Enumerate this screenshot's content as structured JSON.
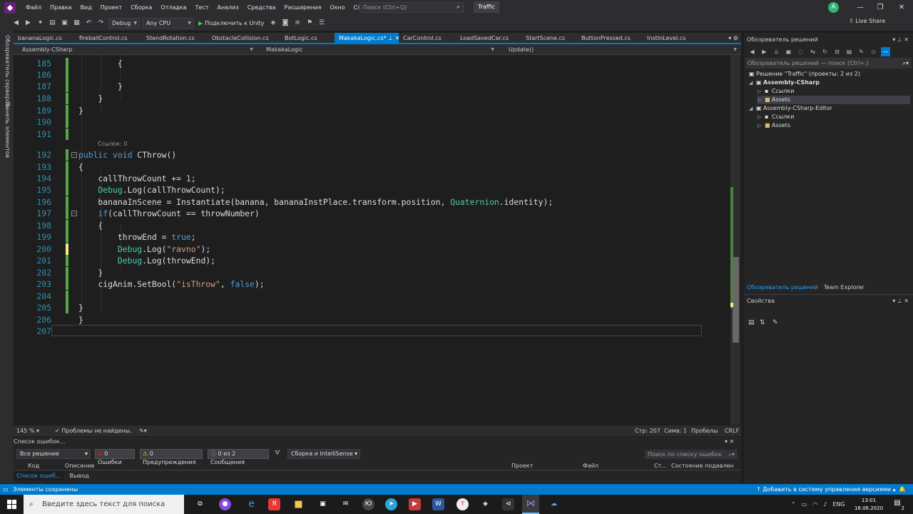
{
  "menu": [
    "Файл",
    "Правка",
    "Вид",
    "Проект",
    "Сборка",
    "Отладка",
    "Тест",
    "Анализ",
    "Средства",
    "Расширения",
    "Окно",
    "Справка"
  ],
  "search": {
    "placeholder": "Поиск (Ctrl+Q)",
    "icon": "search-icon"
  },
  "solution_name": "Traffic",
  "user_initial": "A",
  "toolbar": {
    "config": "Debug",
    "platform": "Any CPU",
    "run_label": "Подключить к Unity",
    "live_share": "Live Share"
  },
  "left_strip": {
    "server_explorer": "Обозреватель серверов",
    "toolbox": "Панель элементов"
  },
  "doc_tabs": [
    {
      "label": "bananaLogic.cs"
    },
    {
      "label": "fireballControl.cs"
    },
    {
      "label": "StendRotation.cs"
    },
    {
      "label": "ObstacleCollision.cs"
    },
    {
      "label": "BotLogic.cs"
    },
    {
      "label": "MakakaLogic.cs*",
      "active": true
    },
    {
      "label": "CarControl.cs"
    },
    {
      "label": "LoadSavedCar.cs"
    },
    {
      "label": "StartScene.cs"
    },
    {
      "label": "ButtonPressed.cs"
    },
    {
      "label": "InstInLevel.cs"
    }
  ],
  "navbar": {
    "project": "Assembly-CSharp",
    "class": "MakakaLogic",
    "member": "Update()"
  },
  "code": {
    "codelens": "Ссылок: 0",
    "lines": [
      {
        "n": "185"
      },
      {
        "n": "186"
      },
      {
        "n": "187"
      },
      {
        "n": "188"
      },
      {
        "n": "189"
      },
      {
        "n": "190"
      },
      {
        "n": "191"
      },
      {
        "n": "192"
      },
      {
        "n": "193"
      },
      {
        "n": "194"
      },
      {
        "n": "195"
      },
      {
        "n": "196"
      },
      {
        "n": "197"
      },
      {
        "n": "198"
      },
      {
        "n": "199"
      },
      {
        "n": "200"
      },
      {
        "n": "201"
      },
      {
        "n": "202"
      },
      {
        "n": "203"
      },
      {
        "n": "204"
      },
      {
        "n": "205"
      },
      {
        "n": "206"
      },
      {
        "n": "207"
      }
    ]
  },
  "editor_status": {
    "zoom": "145 %",
    "issues": "Проблемы не найдены.",
    "line": "Стр: 207",
    "col": "Симв: 1",
    "ws": "Пробелы",
    "eol": "CRLF"
  },
  "error_list": {
    "title": "Список ошибок...",
    "scope": "Все решение",
    "errors": "0 Ошибки",
    "warnings": "0 Предупреждения",
    "messages": "0 из 2 Сообщения",
    "build_filter": "Сборка и IntelliSense",
    "search_placeholder": "Поиск по списку ошибок",
    "columns": [
      "Код",
      "Описание",
      "Проект",
      "Файл",
      "Ст...",
      "Состояние подавлен"
    ],
    "tabs": [
      "Список ошиб...",
      "Вывод"
    ]
  },
  "solution_explorer": {
    "title": "Обозреватель решений",
    "search": "Обозреватель решений — поиск (Ctrl+;)",
    "solution": "Решение \"Traffic\" (проекты: 2 из 2)",
    "proj1": "Assembly-CSharp",
    "refs": "Ссылки",
    "assets": "Assets",
    "proj2": "Assembly-CSharp-Editor",
    "tabs": [
      "Обозреватель решений",
      "Team Explorer"
    ]
  },
  "properties": {
    "title": "Свойства"
  },
  "status": {
    "left": "Элементы сохранены",
    "right": "Добавить в систему управления версиями"
  },
  "taskbar": {
    "search": "Введите здесь текст для поиска",
    "lang": "ENG",
    "time": "13:01",
    "date": "18.06.2020",
    "notif_count": "2"
  },
  "colors": {
    "accent": "#007acc",
    "titlebar": "#2d2d30",
    "editor_bg": "#1e1e1e",
    "keyword": "#569cd6",
    "type": "#4ec9b0",
    "string": "#d69d85"
  }
}
